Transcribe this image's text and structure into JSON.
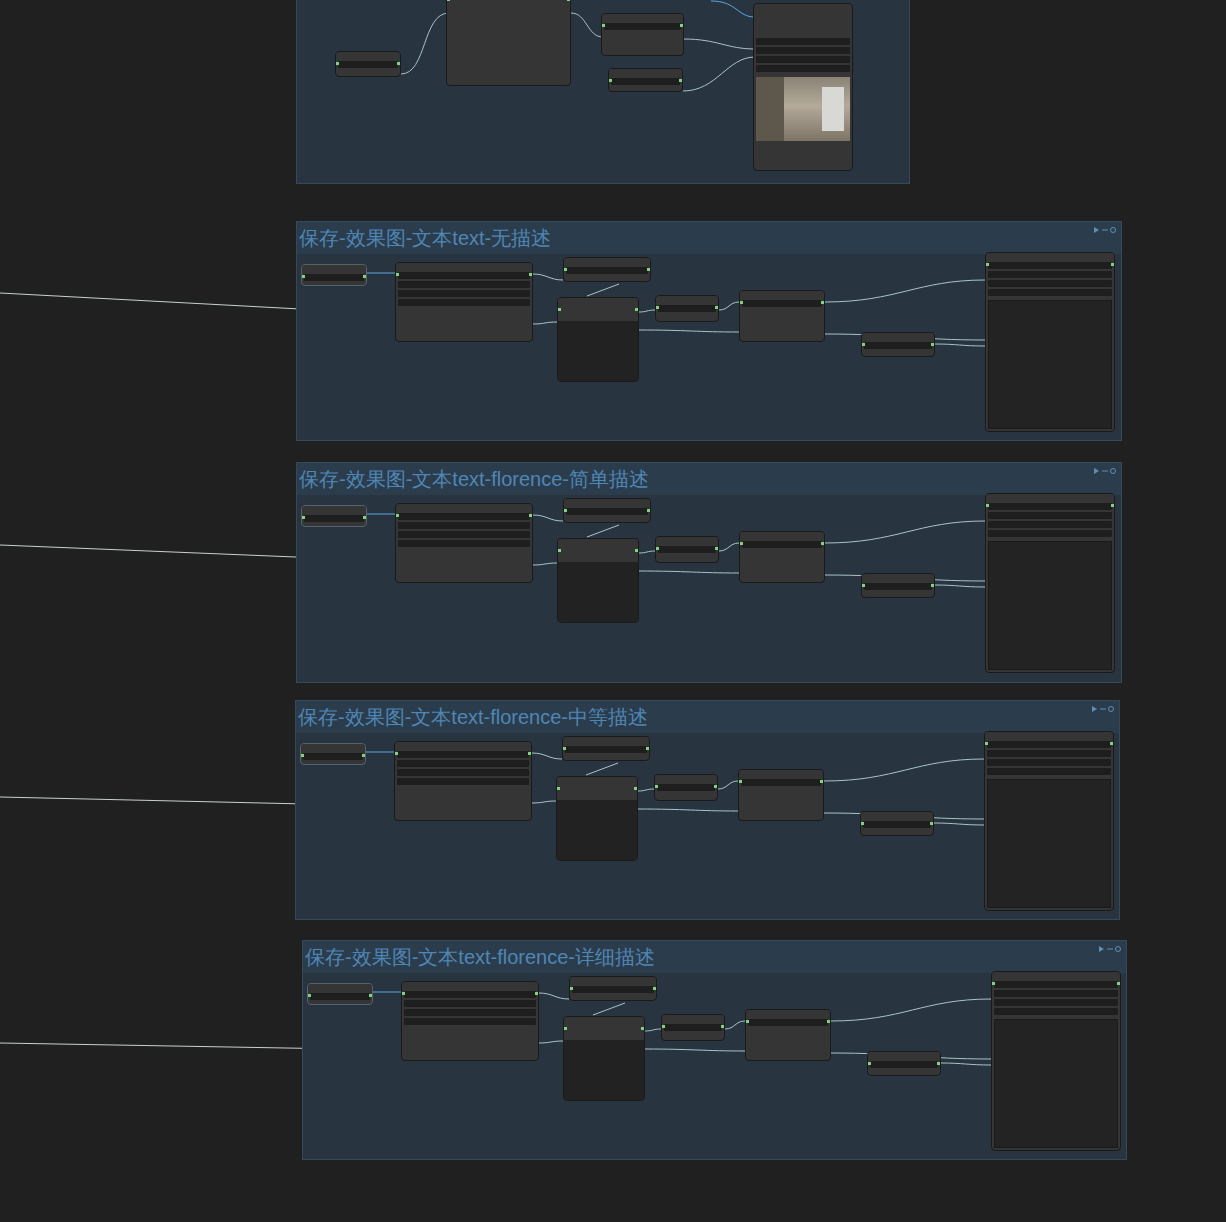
{
  "canvas": {
    "groups": [
      {
        "title": "保存-效果图-文本text-无描述"
      },
      {
        "title": "保存-效果图-文本text-florence-简单描述"
      },
      {
        "title": "保存-效果图-文本text-florence-中等描述"
      },
      {
        "title": "保存-效果图-文本text-florence-详细描述"
      }
    ],
    "top_group": {
      "preview_image": true
    }
  }
}
